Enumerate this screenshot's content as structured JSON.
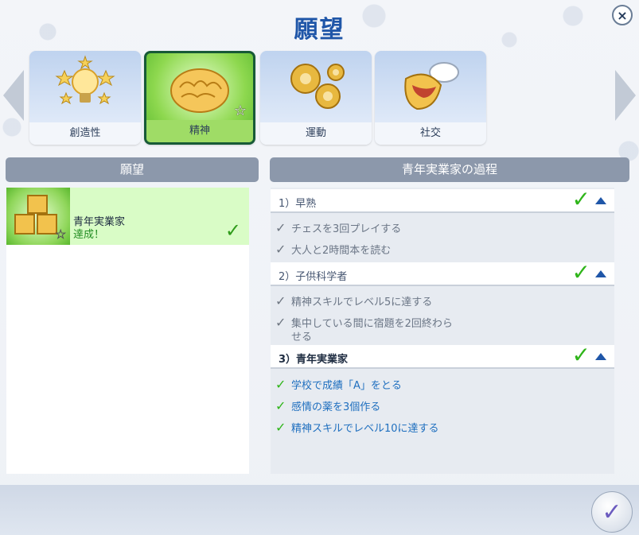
{
  "window": {
    "title": "願望",
    "close_icon": "×"
  },
  "categories": [
    {
      "label": "創造性",
      "icon": "lightbulb-stars-icon"
    },
    {
      "label": "精神",
      "icon": "brain-icon",
      "selected": true
    },
    {
      "label": "運動",
      "icon": "gears-icon"
    },
    {
      "label": "社交",
      "icon": "speech-bubble-mouth-icon"
    }
  ],
  "left_panel": {
    "header": "願望",
    "aspiration": {
      "name": "青年実業家",
      "status": "達成！",
      "check": "✓"
    }
  },
  "right_panel": {
    "header": "青年実業家の過程",
    "milestones": [
      {
        "title": "1）早熟",
        "check": "✓",
        "goals": [
          {
            "text": "チェスを3回プレイする",
            "done": false
          },
          {
            "text": "大人と2時間本を読む",
            "done": false
          }
        ]
      },
      {
        "title": "2）子供科学者",
        "check": "✓",
        "goals": [
          {
            "text": "精神スキルでレベル5に達する",
            "done": false
          },
          {
            "text": "集中している間に宿題を2回終わら",
            "text2": "せる",
            "done": false
          }
        ]
      },
      {
        "title": "3）青年実業家",
        "check": "✓",
        "goals": [
          {
            "text": "学校で成績「A」をとる",
            "done": true
          },
          {
            "text": "感情の薬を3個作る",
            "done": true
          },
          {
            "text": "精神スキルでレベル10に達する",
            "done": true
          }
        ]
      }
    ]
  },
  "footer": {
    "confirm_icon": "✓"
  },
  "colors": {
    "accent_blue": "#1f56a8",
    "success_green": "#2fb51a",
    "selected_green": "#8ed84f"
  }
}
